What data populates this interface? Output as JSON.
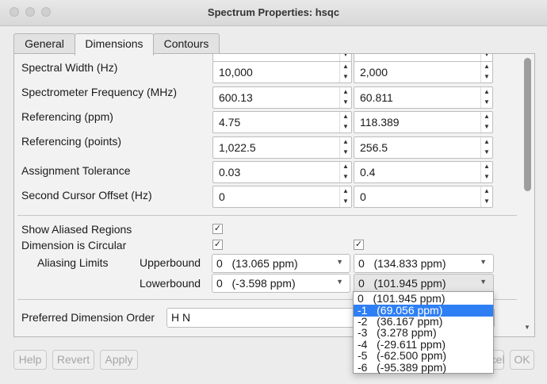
{
  "window": {
    "title": "Spectrum Properties: hsqc"
  },
  "tabs": [
    {
      "label": "General"
    },
    {
      "label": "Dimensions"
    },
    {
      "label": "Contours"
    }
  ],
  "fields": [
    {
      "label": "Spectral Width (Hz)",
      "values": [
        "10,000",
        "2,000"
      ]
    },
    {
      "label": "Spectrometer Frequency (MHz)",
      "values": [
        "600.13",
        "60.811"
      ]
    },
    {
      "label": "Referencing (ppm)",
      "values": [
        "4.75",
        "118.389"
      ]
    },
    {
      "label": "Referencing (points)",
      "values": [
        "1,022.5",
        "256.5"
      ]
    },
    {
      "label": "Assignment Tolerance",
      "values": [
        "0.03",
        "0.4"
      ]
    },
    {
      "label": "Second Cursor Offset (Hz)",
      "values": [
        "0",
        "0"
      ]
    }
  ],
  "checks": {
    "show_aliased": {
      "label": "Show Aliased Regions",
      "value": "✓"
    },
    "circular": {
      "label": "Dimension is Circular",
      "value": "✓"
    }
  },
  "aliasing": {
    "label": "Aliasing Limits",
    "upper_label": "Upperbound",
    "lower_label": "Lowerbound",
    "upper": [
      "0   (13.065 ppm)",
      "0   (134.833 ppm)"
    ],
    "lower": [
      "0   (-3.598 ppm)",
      "0   (101.945 ppm)"
    ]
  },
  "dimension_order": {
    "label": "Preferred Dimension Order",
    "value": "H N"
  },
  "dropdown_options": [
    "0   (101.945 ppm)",
    "-1   (69.056 ppm)",
    "-2   (36.167 ppm)",
    "-3   (3.278 ppm)",
    "-4   (-29.611 ppm)",
    "-5   (-62.500 ppm)",
    "-6   (-95.389 ppm)"
  ],
  "buttons": {
    "help": "Help",
    "revert": "Revert",
    "apply": "Apply",
    "cancel": "Cancel",
    "ok": "OK"
  },
  "icons": {
    "checkmark": "check-icon",
    "dropdown": "chevron-down-icon",
    "spinner": "up-down-arrows-icon"
  }
}
